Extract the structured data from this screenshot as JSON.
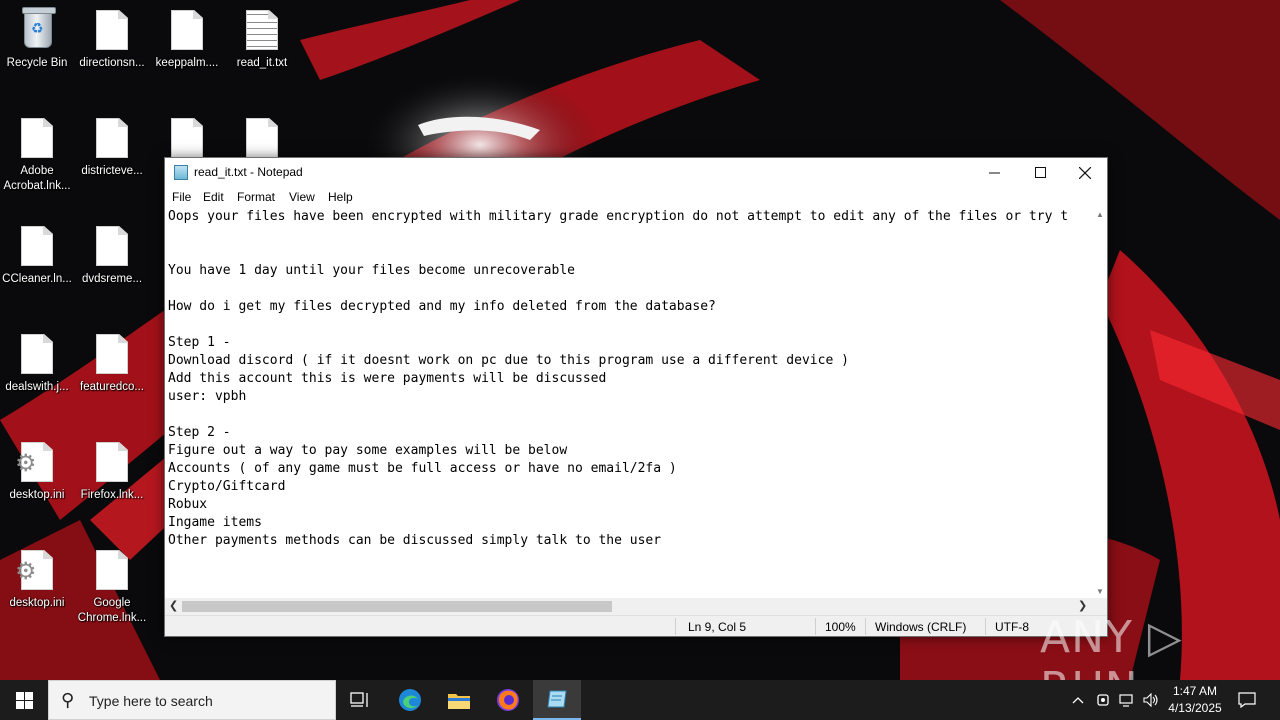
{
  "desktop": {
    "icons": [
      {
        "label": "Recycle Bin"
      },
      {
        "label": "directionsn..."
      },
      {
        "label": "keeppalm...."
      },
      {
        "label": "read_it.txt"
      },
      {
        "label": "Adobe",
        "label2": "Acrobat.lnk..."
      },
      {
        "label": "districteve..."
      },
      {
        "label": "CCleaner.ln..."
      },
      {
        "label": "dvdsreme..."
      },
      {
        "label": "dealswith.j..."
      },
      {
        "label": "featuredco..."
      },
      {
        "label": "desktop.ini"
      },
      {
        "label": "Firefox.lnk..."
      },
      {
        "label": "desktop.ini"
      },
      {
        "label": "Google",
        "label2": "Chrome.lnk..."
      }
    ]
  },
  "notepad": {
    "title": "read_it.txt - Notepad",
    "menu": [
      "File",
      "Edit",
      "Format",
      "View",
      "Help"
    ],
    "content": "Oops your files have been encrypted with military grade encryption do not attempt to edit any of the files or try t\n\n\nYou have 1 day until your files become unrecoverable\n\nHow do i get my files decrypted and my info deleted from the database?\n\nStep 1 -\nDownload discord ( if it doesnt work on pc due to this program use a different device )\nAdd this account this is were payments will be discussed\nuser: vpbh\n\nStep 2 -\nFigure out a way to pay some examples will be below\nAccounts ( of any game must be full access or have no email/2fa )\nCrypto/Giftcard\nRobux\nIngame items\nOther payments methods can be discussed simply talk to the user",
    "status": {
      "position": "Ln 9, Col 5",
      "zoom": "100%",
      "line_ending": "Windows (CRLF)",
      "encoding": "UTF-8"
    }
  },
  "watermark": "ANY ▷ RUN",
  "taskbar": {
    "search_placeholder": "Type here to search",
    "time": "1:47 AM",
    "date": "4/13/2025"
  }
}
